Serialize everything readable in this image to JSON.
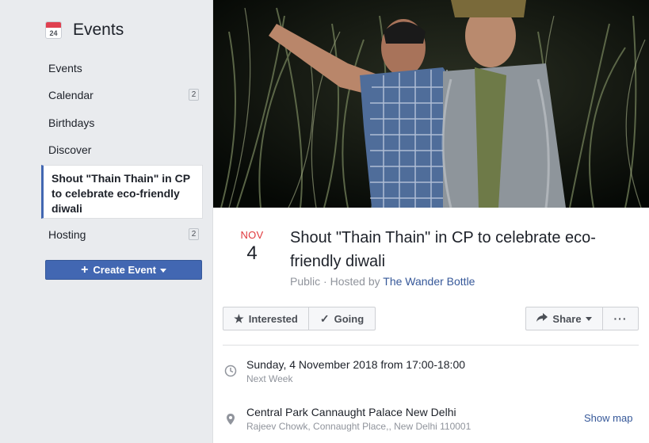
{
  "sidebar": {
    "title": "Events",
    "calendar_icon_day": "24",
    "items": [
      {
        "label": "Events",
        "badge": ""
      },
      {
        "label": "Calendar",
        "badge": "2"
      },
      {
        "label": "Birthdays",
        "badge": ""
      },
      {
        "label": "Discover",
        "badge": ""
      }
    ],
    "selected_event": "Shout \"Thain Thain\" in CP to celebrate eco-friendly diwali",
    "hosting": {
      "label": "Hosting",
      "badge": "2"
    },
    "create_button": "Create Event"
  },
  "event": {
    "month": "NOV",
    "day": "4",
    "title": "Shout \"Thain Thain\" in CP to celebrate eco-friendly diwali",
    "privacy": "Public",
    "hosted_by_prefix": " · Hosted by ",
    "host": "The Wander Bottle",
    "actions": {
      "interested": "Interested",
      "going": "Going",
      "share": "Share",
      "more": "···"
    },
    "time": {
      "main": "Sunday, 4 November 2018 from 17:00-18:00",
      "sub": "Next Week"
    },
    "location": {
      "main": "Central Park Cannaught Palace New Delhi",
      "sub": "Rajeev Chowk, Connaught Place,, New Delhi 110001",
      "show_map": "Show map"
    }
  },
  "colors": {
    "accent": "#4267b2",
    "month_red": "#e0393e",
    "link": "#365899",
    "sidebar_bg": "#e9ebee"
  },
  "icons": {
    "calendar": "calendar-icon",
    "star": "star-icon",
    "check": "check-icon",
    "share": "share-arrow-icon",
    "clock": "clock-icon",
    "pin": "location-pin-icon"
  }
}
